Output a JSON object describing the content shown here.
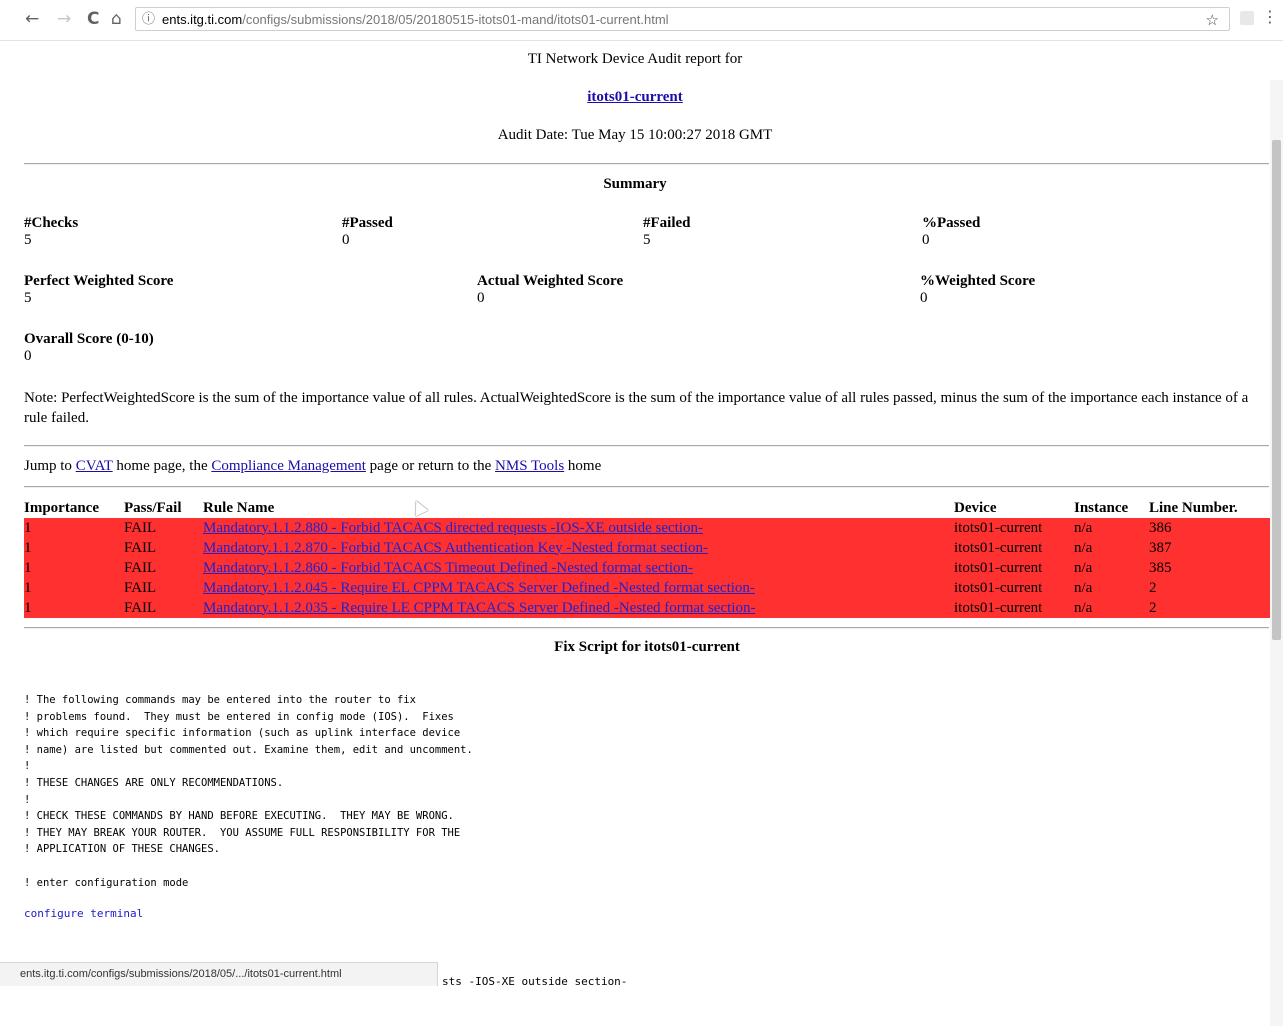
{
  "browser": {
    "url_host": "ents.itg.ti.com",
    "url_path": "/configs/submissions/2018/05/20180515-itots01-mand/itots01-current.html",
    "back_icon": "←",
    "forward_icon": "→",
    "reload_icon": "C",
    "home_icon": "⌂",
    "info_icon": "ⓘ",
    "star_icon": "☆",
    "menu_icon": "⋮",
    "status_url": "ents.itg.ti.com/configs/submissions/2018/05/.../itots01-current.html"
  },
  "report": {
    "title": "TI Network Device Audit report for",
    "host": "itots01-current",
    "audit_date": "Audit Date: Tue May 15 10:00:27 2018 GMT",
    "summary_title": "Summary",
    "stats": {
      "checks_label": "#Checks",
      "checks_value": "5",
      "passed_label": "#Passed",
      "passed_value": "0",
      "failed_label": "#Failed",
      "failed_value": "5",
      "pct_passed_label": "%Passed",
      "pct_passed_value": "0",
      "perfect_label": "Perfect Weighted Score",
      "perfect_value": "5",
      "actual_label": "Actual Weighted Score",
      "actual_value": "0",
      "pct_weighted_label": "%Weighted Score",
      "pct_weighted_value": "0",
      "overall_label": "Ovarall Score (0-10)",
      "overall_value": "0"
    },
    "note": "Note: PerfectWeightedScore is the sum of the importance value of all rules. ActualWeightedScore is the sum of the importance value of all rules passed, minus the sum of the importance each instance of a rule failed.",
    "jump": {
      "prefix": "Jump to",
      "link1": "CVAT",
      "middle1": "home page, the",
      "link2": "Compliance Management",
      "middle2": "page or return to the",
      "link3": "NMS Tools",
      "suffix": "home"
    },
    "table": {
      "headers": [
        "Importance",
        "Pass/Fail",
        "Rule Name",
        "Device",
        "Instance",
        "Line Number."
      ],
      "rows": [
        {
          "importance": "1",
          "result": "FAIL",
          "rule": "Mandatory.1.1.2.880 - Forbid TACACS directed requests -IOS-XE outside section-",
          "device": "itots01-current",
          "instance": "n/a",
          "line": "386"
        },
        {
          "importance": "1",
          "result": "FAIL",
          "rule": "Mandatory.1.1.2.870 - Forbid TACACS Authentication Key -Nested format section-",
          "device": "itots01-current",
          "instance": "n/a",
          "line": "387"
        },
        {
          "importance": "1",
          "result": "FAIL",
          "rule": "Mandatory.1.1.2.860 - Forbid TACACS Timeout Defined -Nested format section-",
          "device": "itots01-current",
          "instance": "n/a",
          "line": "385"
        },
        {
          "importance": "1",
          "result": "FAIL",
          "rule": "Mandatory.1.1.2.045 - Require EL CPPM TACACS Server Defined -Nested format section-",
          "device": "itots01-current",
          "instance": "n/a",
          "line": "2"
        },
        {
          "importance": "1",
          "result": "FAIL",
          "rule": "Mandatory.1.1.2.035 - Require LE CPPM TACACS Server Defined -Nested format section-",
          "device": "itots01-current",
          "instance": "n/a",
          "line": "2"
        }
      ]
    },
    "fix_title": "Fix Script for itots01-current",
    "script_text": "! The following commands may be entered into the router to fix\n! problems found.  They must be entered in config mode (IOS).  Fixes\n! which require specific information (such as uplink interface device\n! name) are listed but commented out. Examine them, edit and uncomment.\n!\n! THESE CHANGES ARE ONLY RECOMMENDATIONS.\n!\n! CHECK THESE COMMANDS BY HAND BEFORE EXECUTING.  THEY MAY BE WRONG.\n! THEY MAY BREAK YOUR ROUTER.  YOU ASSUME FULL RESPONSIBILITY FOR THE\n! APPLICATION OF THESE CHANGES.\n\n! enter configuration mode",
    "config_cmd": "configure terminal",
    "cut_text": "sts -IOS-XE outside section-"
  }
}
